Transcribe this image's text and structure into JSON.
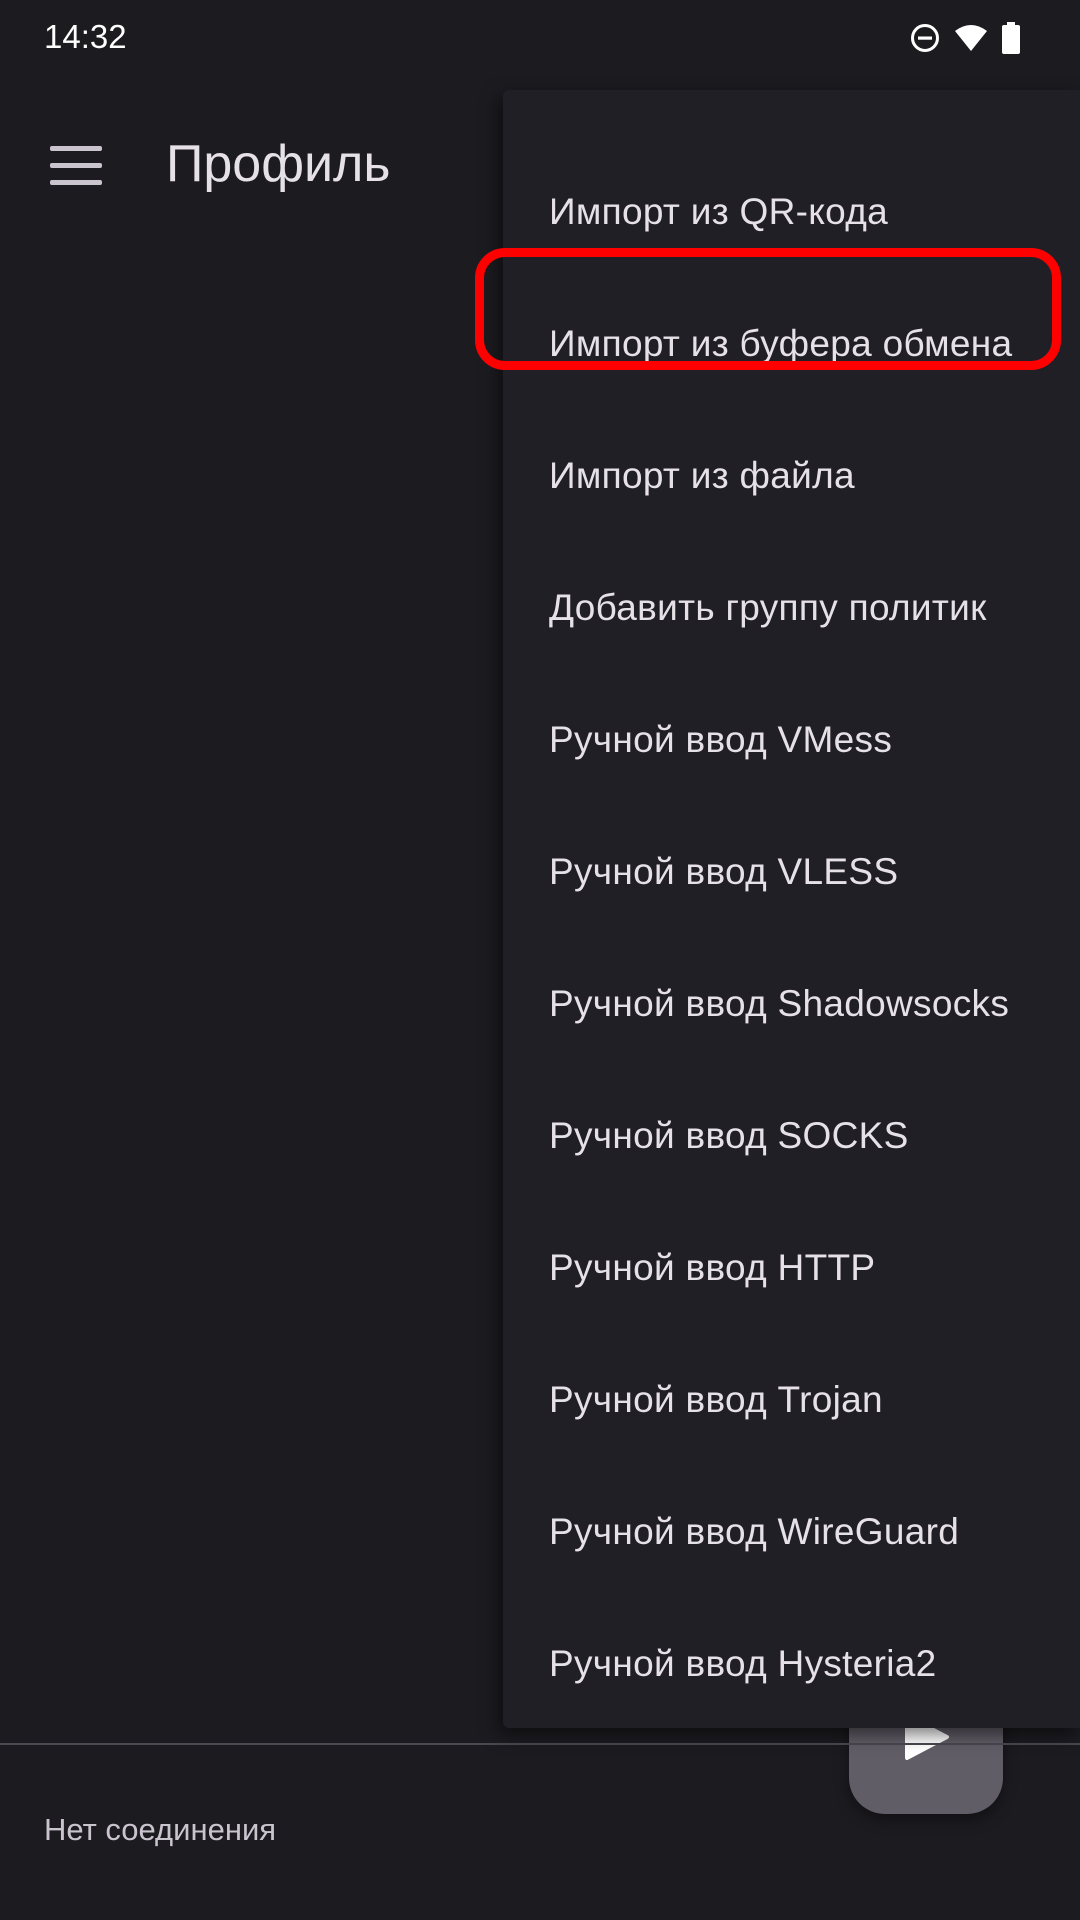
{
  "status_bar": {
    "time": "14:32",
    "icons": [
      "do-not-disturb-icon",
      "wifi-icon",
      "battery-icon"
    ]
  },
  "app_bar": {
    "menu_icon": "menu-icon",
    "title": "Профиль"
  },
  "popup_menu": {
    "items": [
      {
        "label": "Импорт из QR-кода"
      },
      {
        "label": "Импорт из буфера обмена",
        "highlighted": true
      },
      {
        "label": "Импорт из файла"
      },
      {
        "label": "Добавить группу политик"
      },
      {
        "label": "Ручной ввод VMess"
      },
      {
        "label": "Ручной ввод VLESS"
      },
      {
        "label": "Ручной ввод Shadowsocks"
      },
      {
        "label": "Ручной ввод SOCKS"
      },
      {
        "label": "Ручной ввод HTTP"
      },
      {
        "label": "Ручной ввод Trojan"
      },
      {
        "label": "Ручной ввод WireGuard"
      },
      {
        "label": "Ручной ввод Hysteria2"
      }
    ]
  },
  "bottom": {
    "connection_status": "Нет соединения",
    "fab_icon": "play-icon"
  },
  "colors": {
    "background": "#1c1b20",
    "menu_background": "#211f26",
    "text_primary": "#e6e1e6",
    "fab": "#605d66",
    "highlight": "#ff0000"
  }
}
